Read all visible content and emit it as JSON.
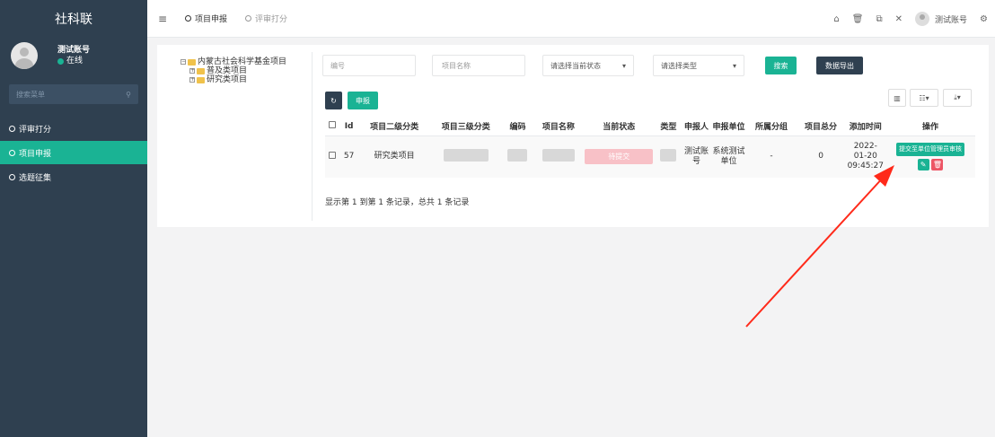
{
  "sidebar": {
    "brand": "社科联",
    "user_name": "测试账号",
    "user_status": "在线",
    "menu_search_placeholder": "搜索菜单",
    "items": [
      {
        "label": "评审打分",
        "active": false
      },
      {
        "label": "项目申报",
        "active": true
      },
      {
        "label": "选题征集",
        "active": false
      }
    ]
  },
  "topbar": {
    "tabs": [
      {
        "label": "项目申报",
        "active": true
      },
      {
        "label": "评审打分",
        "active": false
      }
    ],
    "user_name": "测试账号"
  },
  "tree": {
    "root": "内蒙古社会科学基金项目",
    "children": [
      "普及类项目",
      "研究类项目"
    ]
  },
  "filters": {
    "code_placeholder": "编号",
    "name_placeholder": "项目名称",
    "status_select": "请选择当前状态",
    "type_select": "请选择类型",
    "search_label": "搜索",
    "export_label": "数据导出"
  },
  "toolbar": {
    "refresh_icon": "↻",
    "declare_label": "申报"
  },
  "table": {
    "headers": [
      "Id",
      "项目二级分类",
      "项目三级分类",
      "编码",
      "项目名称",
      "当前状态",
      "类型",
      "申报人",
      "申报单位",
      "所属分组",
      "项目总分",
      "添加时间",
      "操作"
    ],
    "row": {
      "id": "57",
      "category2": "研究类项目",
      "status": "待提交",
      "applicant": "测试账号",
      "unit": "系统测试单位",
      "group": "-",
      "score": "0",
      "time_date": "2022-01-20",
      "time_clock": "09:45:27",
      "action_label": "提交至单位管理员审核"
    }
  },
  "summary": "显示第 1 到第 1 条记录，总共 1 条记录",
  "colors": {
    "sidebar": "#2f4050",
    "accent": "#1ab394",
    "danger": "#ed5565",
    "arrow": "#ff2a1a"
  }
}
